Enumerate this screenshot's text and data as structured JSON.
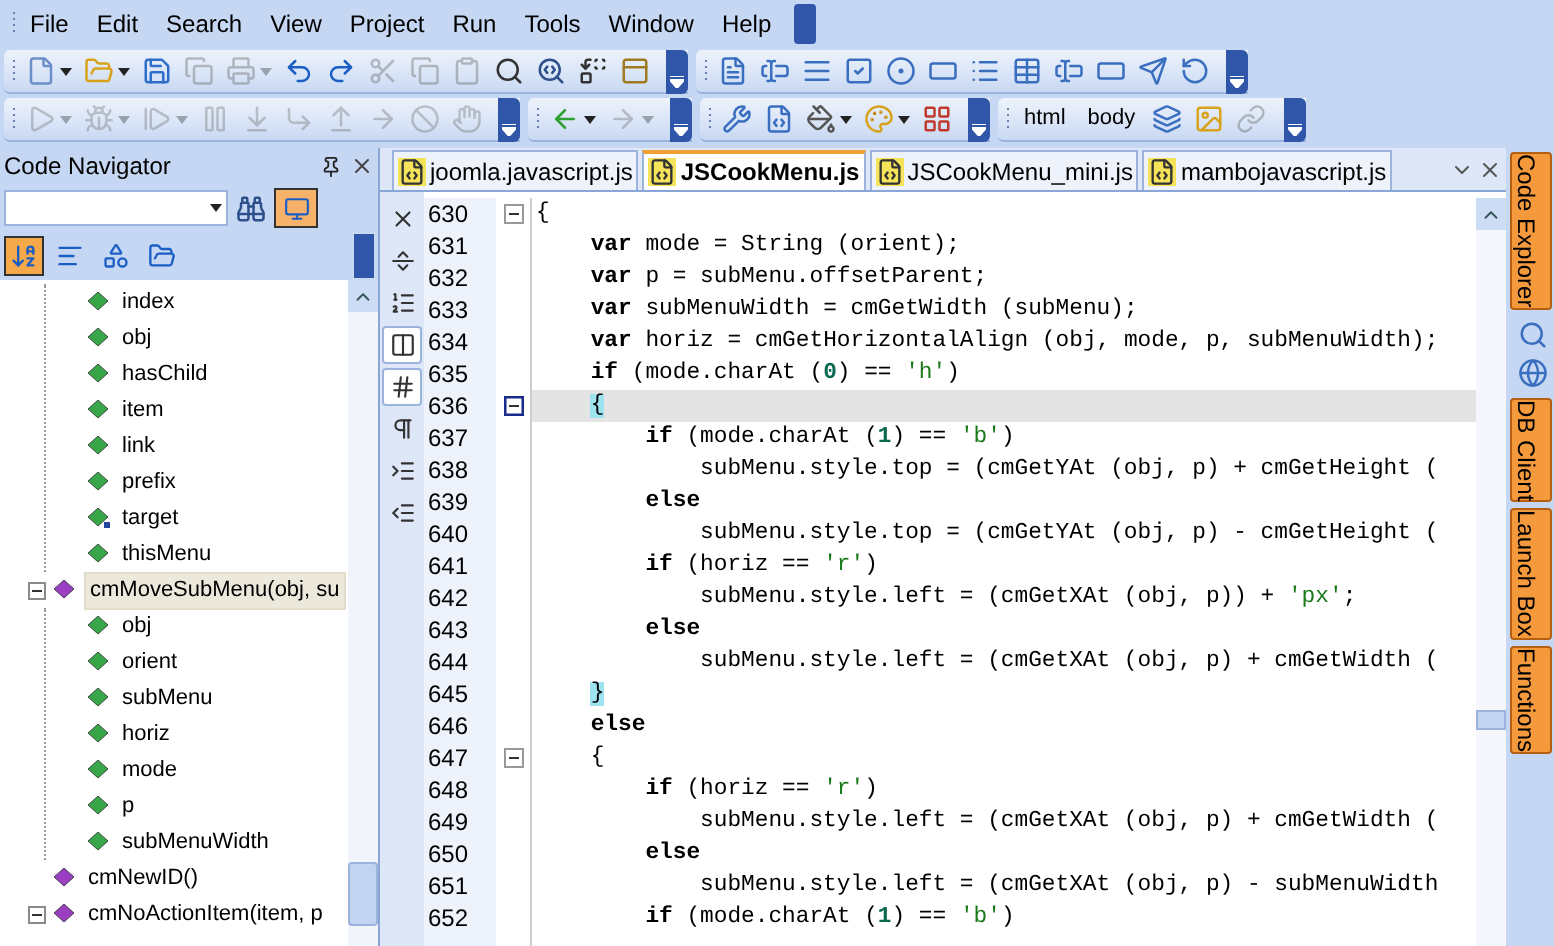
{
  "menu": [
    "File",
    "Edit",
    "Search",
    "View",
    "Project",
    "Run",
    "Tools",
    "Window",
    "Help"
  ],
  "toolbar_rows": [
    {
      "toolbars": [
        {
          "items": [
            {
              "kind": "new",
              "disabled": false,
              "dropdown": true
            },
            {
              "kind": "open",
              "disabled": false,
              "dropdown": true
            },
            {
              "kind": "save",
              "disabled": false,
              "dropdown": false
            },
            {
              "kind": "saveall",
              "disabled": true,
              "dropdown": false
            },
            {
              "kind": "print",
              "disabled": true,
              "dropdown": true
            },
            {
              "kind": "undo",
              "disabled": false,
              "dropdown": false
            },
            {
              "kind": "redo",
              "disabled": false,
              "dropdown": false
            },
            {
              "kind": "cut",
              "disabled": true,
              "dropdown": false
            },
            {
              "kind": "copy",
              "disabled": true,
              "dropdown": false
            },
            {
              "kind": "paste",
              "disabled": true,
              "dropdown": false
            },
            {
              "kind": "find",
              "disabled": false,
              "dropdown": false
            },
            {
              "kind": "findnext",
              "disabled": false,
              "dropdown": false
            },
            {
              "kind": "replace",
              "disabled": false,
              "dropdown": false
            },
            {
              "kind": "frame",
              "disabled": false,
              "dropdown": false
            }
          ]
        },
        {
          "items": [
            {
              "kind": "page",
              "disabled": false,
              "dropdown": false
            },
            {
              "kind": "input",
              "disabled": false,
              "dropdown": false
            },
            {
              "kind": "textarea",
              "disabled": false,
              "dropdown": false
            },
            {
              "kind": "checkbox",
              "disabled": false,
              "dropdown": false
            },
            {
              "kind": "radio",
              "disabled": false,
              "dropdown": false
            },
            {
              "kind": "label",
              "disabled": false,
              "dropdown": false
            },
            {
              "kind": "list",
              "disabled": false,
              "dropdown": false
            },
            {
              "kind": "table",
              "disabled": false,
              "dropdown": false
            },
            {
              "kind": "field",
              "disabled": false,
              "dropdown": false
            },
            {
              "kind": "box",
              "disabled": false,
              "dropdown": false
            },
            {
              "kind": "submit",
              "disabled": false,
              "dropdown": false
            },
            {
              "kind": "reset",
              "disabled": false,
              "dropdown": false
            }
          ]
        }
      ]
    },
    {
      "toolbars": [
        {
          "items": [
            {
              "kind": "run",
              "disabled": true,
              "dropdown": true
            },
            {
              "kind": "debug",
              "disabled": true,
              "dropdown": true
            },
            {
              "kind": "step",
              "disabled": true,
              "dropdown": true
            },
            {
              "kind": "pause",
              "disabled": true,
              "dropdown": false
            },
            {
              "kind": "stepinto",
              "disabled": true,
              "dropdown": false
            },
            {
              "kind": "stepover",
              "disabled": true,
              "dropdown": false
            },
            {
              "kind": "stepout",
              "disabled": true,
              "dropdown": false
            },
            {
              "kind": "runto",
              "disabled": true,
              "dropdown": false
            },
            {
              "kind": "stop",
              "disabled": true,
              "dropdown": false
            },
            {
              "kind": "hand",
              "disabled": true,
              "dropdown": false
            }
          ]
        },
        {
          "items": [
            {
              "kind": "back",
              "disabled": false,
              "dropdown": true
            },
            {
              "kind": "forward",
              "disabled": true,
              "dropdown": true
            }
          ]
        },
        {
          "items": [
            {
              "kind": "tools",
              "disabled": false,
              "dropdown": false
            },
            {
              "kind": "file",
              "disabled": false,
              "dropdown": false
            },
            {
              "kind": "fill",
              "disabled": false,
              "dropdown": true
            },
            {
              "kind": "color",
              "disabled": false,
              "dropdown": true
            },
            {
              "kind": "grid",
              "disabled": false,
              "dropdown": false
            }
          ]
        },
        {
          "items": [
            {
              "kind": "text",
              "label": "html",
              "disabled": false,
              "dropdown": false
            },
            {
              "kind": "text",
              "label": "body",
              "disabled": false,
              "dropdown": false
            },
            {
              "kind": "layers",
              "disabled": false,
              "dropdown": false
            },
            {
              "kind": "image",
              "disabled": false,
              "dropdown": false
            },
            {
              "kind": "link",
              "disabled": true,
              "dropdown": false
            }
          ]
        }
      ]
    }
  ],
  "navigator": {
    "title": "Code Navigator",
    "filter_active": true,
    "view_buttons": [
      {
        "selected": true
      },
      {
        "selected": false
      },
      {
        "selected": false
      },
      {
        "selected": false
      }
    ],
    "tree": [
      {
        "kind": "group",
        "children": [
          {
            "label": "index",
            "kind": "variable",
            "selected": false
          },
          {
            "label": "obj",
            "kind": "variable",
            "selected": false
          },
          {
            "label": "hasChild",
            "kind": "variable",
            "selected": false
          },
          {
            "label": "item",
            "kind": "variable",
            "selected": false
          },
          {
            "label": "link",
            "kind": "variable",
            "selected": false
          },
          {
            "label": "prefix",
            "kind": "variable",
            "selected": false
          },
          {
            "label": "target",
            "kind": "reference",
            "selected": false
          },
          {
            "label": "thisMenu",
            "kind": "variable",
            "selected": false
          }
        ]
      },
      {
        "label": "cmMoveSubMenu(obj, su",
        "kind": "function",
        "selected": true,
        "expanded": true,
        "children": [
          {
            "label": "obj",
            "kind": "variable",
            "selected": false
          },
          {
            "label": "orient",
            "kind": "variable",
            "selected": false
          },
          {
            "label": "subMenu",
            "kind": "variable",
            "selected": false
          },
          {
            "label": "horiz",
            "kind": "variable",
            "selected": false
          },
          {
            "label": "mode",
            "kind": "variable",
            "selected": false
          },
          {
            "label": "p",
            "kind": "variable",
            "selected": false
          },
          {
            "label": "subMenuWidth",
            "kind": "variable",
            "selected": false
          }
        ]
      },
      {
        "label": "cmNewID()",
        "kind": "function",
        "selected": false
      },
      {
        "label": "cmNoActionItem(item, p",
        "kind": "function",
        "selected": false,
        "expanded": true
      }
    ]
  },
  "editor": {
    "tabs": [
      {
        "label": "joomla.javascript.js",
        "selected": false
      },
      {
        "label": "JSCookMenu.js",
        "selected": true
      },
      {
        "label": "JSCookMenu_mini.js",
        "selected": false
      },
      {
        "label": "mambojavascript.js",
        "selected": false
      }
    ],
    "gutter_tools": [
      {
        "kind": "close",
        "selected": false
      },
      {
        "kind": "split",
        "selected": false
      },
      {
        "kind": "lines",
        "selected": false
      },
      {
        "kind": "columns",
        "selected": true
      },
      {
        "kind": "hash",
        "selected": true
      },
      {
        "kind": "pilcrow",
        "selected": false
      },
      {
        "kind": "indent",
        "selected": false
      },
      {
        "kind": "outdent",
        "selected": false
      }
    ],
    "lines": [
      {
        "number": "630",
        "current": false,
        "fold": true,
        "segments": [
          {
            "kind": "plain",
            "text": "{"
          }
        ]
      },
      {
        "number": "631",
        "current": false,
        "fold": false,
        "segments": [
          {
            "kind": "keyword",
            "text": "    var"
          },
          {
            "kind": "plain",
            "text": " mode = String (orient);"
          }
        ]
      },
      {
        "number": "632",
        "current": false,
        "fold": false,
        "segments": [
          {
            "kind": "keyword",
            "text": "    var"
          },
          {
            "kind": "plain",
            "text": " p = subMenu.offsetParent;"
          }
        ]
      },
      {
        "number": "633",
        "current": false,
        "fold": false,
        "segments": [
          {
            "kind": "keyword",
            "text": "    var"
          },
          {
            "kind": "plain",
            "text": " subMenuWidth = cmGetWidth (subMenu);"
          }
        ]
      },
      {
        "number": "634",
        "current": false,
        "fold": false,
        "segments": [
          {
            "kind": "keyword",
            "text": "    var"
          },
          {
            "kind": "plain",
            "text": " horiz = cmGetHorizontalAlign (obj, mode, p, subMenuWidth);"
          }
        ]
      },
      {
        "number": "635",
        "current": false,
        "fold": false,
        "segments": [
          {
            "kind": "keyword",
            "text": "    if"
          },
          {
            "kind": "plain",
            "text": " (mode.charAt ("
          },
          {
            "kind": "number",
            "text": "0"
          },
          {
            "kind": "plain",
            "text": ") == "
          },
          {
            "kind": "string",
            "text": "'h'"
          },
          {
            "kind": "plain",
            "text": ")"
          }
        ]
      },
      {
        "number": "636",
        "current": true,
        "fold": true,
        "segments": [
          {
            "kind": "brace",
            "text": "    {"
          }
        ]
      },
      {
        "number": "637",
        "current": false,
        "fold": false,
        "segments": [
          {
            "kind": "keyword",
            "text": "        if"
          },
          {
            "kind": "plain",
            "text": " (mode.charAt ("
          },
          {
            "kind": "number",
            "text": "1"
          },
          {
            "kind": "plain",
            "text": ") == "
          },
          {
            "kind": "string",
            "text": "'b'"
          },
          {
            "kind": "plain",
            "text": ")"
          }
        ]
      },
      {
        "number": "638",
        "current": false,
        "fold": false,
        "segments": [
          {
            "kind": "plain",
            "text": "            subMenu.style.top = (cmGetYAt (obj, p) + cmGetHeight ("
          }
        ]
      },
      {
        "number": "639",
        "current": false,
        "fold": false,
        "segments": [
          {
            "kind": "keyword",
            "text": "        else"
          }
        ]
      },
      {
        "number": "640",
        "current": false,
        "fold": false,
        "segments": [
          {
            "kind": "plain",
            "text": "            subMenu.style.top = (cmGetYAt (obj, p) - cmGetHeight ("
          }
        ]
      },
      {
        "number": "641",
        "current": false,
        "fold": false,
        "segments": [
          {
            "kind": "keyword",
            "text": "        if"
          },
          {
            "kind": "plain",
            "text": " (horiz == "
          },
          {
            "kind": "string",
            "text": "'r'"
          },
          {
            "kind": "plain",
            "text": ")"
          }
        ]
      },
      {
        "number": "642",
        "current": false,
        "fold": false,
        "segments": [
          {
            "kind": "plain",
            "text": "            subMenu.style.left = (cmGetXAt (obj, p)) + "
          },
          {
            "kind": "string",
            "text": "'px'"
          },
          {
            "kind": "plain",
            "text": ";"
          }
        ]
      },
      {
        "number": "643",
        "current": false,
        "fold": false,
        "segments": [
          {
            "kind": "keyword",
            "text": "        else"
          }
        ]
      },
      {
        "number": "644",
        "current": false,
        "fold": false,
        "segments": [
          {
            "kind": "plain",
            "text": "            subMenu.style.left = (cmGetXAt (obj, p) + cmGetWidth ("
          }
        ]
      },
      {
        "number": "645",
        "current": false,
        "fold": false,
        "segments": [
          {
            "kind": "brace",
            "text": "    }"
          }
        ]
      },
      {
        "number": "646",
        "current": false,
        "fold": false,
        "segments": [
          {
            "kind": "keyword",
            "text": "    else"
          }
        ]
      },
      {
        "number": "647",
        "current": false,
        "fold": true,
        "segments": [
          {
            "kind": "plain",
            "text": "    {"
          }
        ]
      },
      {
        "number": "648",
        "current": false,
        "fold": false,
        "segments": [
          {
            "kind": "keyword",
            "text": "        if"
          },
          {
            "kind": "plain",
            "text": " (horiz == "
          },
          {
            "kind": "string",
            "text": "'r'"
          },
          {
            "kind": "plain",
            "text": ")"
          }
        ]
      },
      {
        "number": "649",
        "current": false,
        "fold": false,
        "segments": [
          {
            "kind": "plain",
            "text": "            subMenu.style.left = (cmGetXAt (obj, p) + cmGetWidth ("
          }
        ]
      },
      {
        "number": "650",
        "current": false,
        "fold": false,
        "segments": [
          {
            "kind": "keyword",
            "text": "        else"
          }
        ]
      },
      {
        "number": "651",
        "current": false,
        "fold": false,
        "segments": [
          {
            "kind": "plain",
            "text": "            subMenu.style.left = (cmGetXAt (obj, p) - subMenuWidth"
          }
        ]
      },
      {
        "number": "652",
        "current": false,
        "fold": false,
        "segments": [
          {
            "kind": "keyword",
            "text": "        if"
          },
          {
            "kind": "plain",
            "text": " (mode.charAt ("
          },
          {
            "kind": "number",
            "text": "1"
          },
          {
            "kind": "plain",
            "text": ") == "
          },
          {
            "kind": "string",
            "text": "'b'"
          },
          {
            "kind": "plain",
            "text": ")"
          }
        ]
      }
    ]
  },
  "side_panels": [
    {
      "kind": "tab",
      "label": "Code Explorer"
    },
    {
      "kind": "icons"
    },
    {
      "kind": "tab",
      "label": "DB Client"
    },
    {
      "kind": "tab",
      "label": "Launch Box"
    },
    {
      "kind": "tab",
      "label": "Functions"
    }
  ]
}
